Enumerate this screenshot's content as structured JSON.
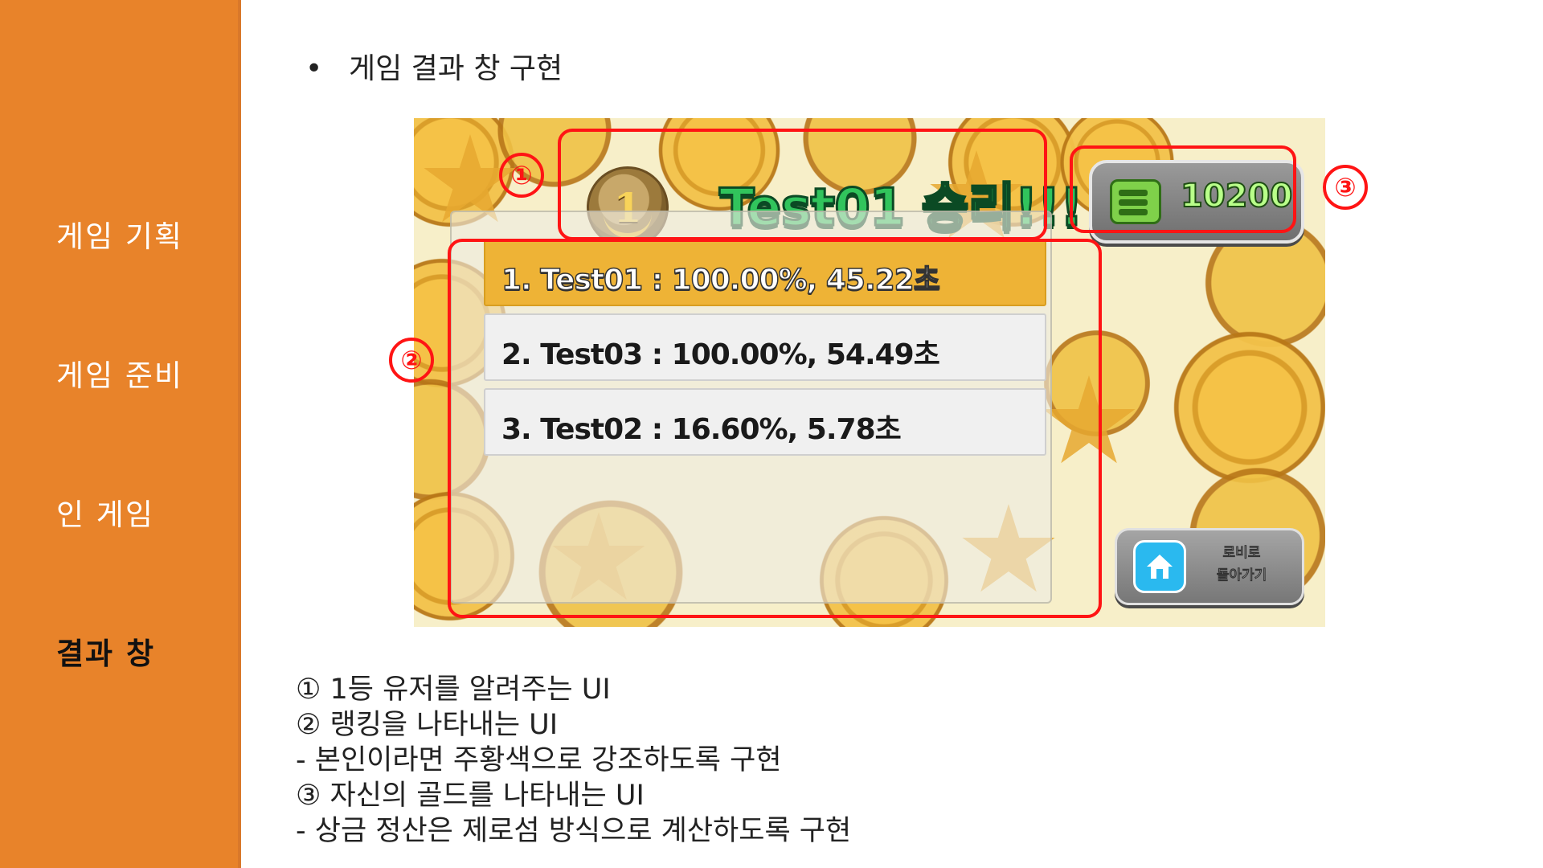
{
  "sidebar": {
    "items": [
      {
        "label": "게임 기획",
        "active": false
      },
      {
        "label": "게임 준비",
        "active": false
      },
      {
        "label": "인 게임",
        "active": false
      },
      {
        "label": "결과 창",
        "active": true
      }
    ],
    "colors": {
      "background": "#e8832a",
      "text": "#ffffff",
      "active_text": "#111111"
    }
  },
  "heading": {
    "bullet": "•",
    "text": "게임 결과 창 구현"
  },
  "game": {
    "winner": {
      "medal_rank": "1",
      "text": "Test01 승리!!!"
    },
    "gold": {
      "icon": "money-icon",
      "value": "10200"
    },
    "ranking": [
      {
        "text": "1. Test01 : 100.00%, 45.22초",
        "highlighted": true
      },
      {
        "text": "2. Test03 : 100.00%, 54.49초",
        "highlighted": false
      },
      {
        "text": "3. Test02 : 16.60%, 5.78초",
        "highlighted": false
      }
    ],
    "lobby_button": {
      "icon": "home-icon",
      "line1": "로비로",
      "line2": "돌아가기"
    },
    "colors": {
      "highlight_row": "#eeb336",
      "winner_text": "#31c45c",
      "annotation": "#ff1414"
    }
  },
  "annotations": {
    "one": "①",
    "two": "②",
    "three": "③"
  },
  "description": {
    "lines": [
      "① 1등 유저를 알려주는 UI",
      "② 랭킹을 나타내는 UI",
      " - 본인이라면 주황색으로 강조하도록 구현",
      "③ 자신의 골드를 나타내는 UI",
      " - 상금 정산은 제로섬 방식으로 계산하도록 구현"
    ]
  }
}
